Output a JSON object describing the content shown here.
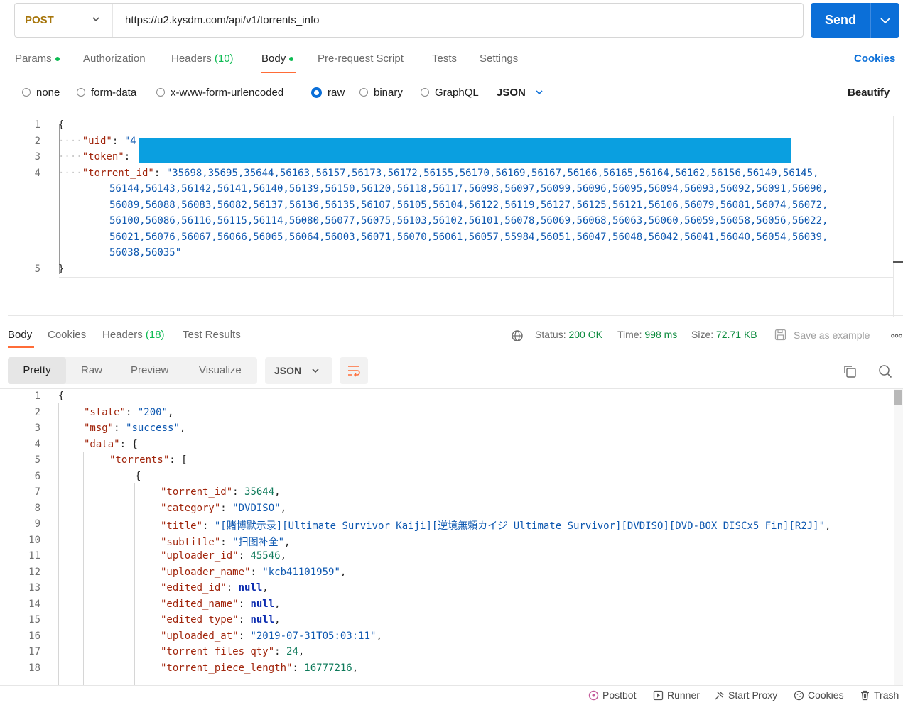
{
  "request": {
    "method": "POST",
    "url": "https://u2.kysdm.com/api/v1/torrents_info",
    "send_label": "Send"
  },
  "request_tabs": {
    "params": "Params",
    "authorization": "Authorization",
    "headers": "Headers",
    "headers_count": "(10)",
    "body": "Body",
    "prerequest": "Pre-request Script",
    "tests": "Tests",
    "settings": "Settings",
    "cookies": "Cookies"
  },
  "body_types": {
    "none": "none",
    "form_data": "form-data",
    "urlencoded": "x-www-form-urlencoded",
    "raw": "raw",
    "binary": "binary",
    "graphql": "GraphQL",
    "format": "JSON",
    "beautify": "Beautify"
  },
  "request_body": {
    "line_numbers": [
      "1",
      "2",
      "3",
      "4",
      "5"
    ],
    "open": "{",
    "close": "}",
    "uid_key": "\"uid\"",
    "uid_value_partial": "\"4",
    "token_key": "\"token\"",
    "torrent_id_key": "\"torrent_id\"",
    "torrent_id_lines": [
      "\"35698,35695,35644,56163,56157,56173,56172,56155,56170,56169,56167,56166,56165,56164,56162,56156,56149,56145,",
      "56144,56143,56142,56141,56140,56139,56150,56120,56118,56117,56098,56097,56099,56096,56095,56094,56093,56092,56091,56090,",
      "56089,56088,56083,56082,56137,56136,56135,56107,56105,56104,56122,56119,56127,56125,56121,56106,56079,56081,56074,56072,",
      "56100,56086,56116,56115,56114,56080,56077,56075,56103,56102,56101,56078,56069,56068,56063,56060,56059,56058,56056,56022,",
      "56021,56076,56067,56066,56065,56064,56003,56071,56070,56061,56057,55984,56051,56047,56048,56042,56041,56040,56054,56039,",
      "56038,56035\""
    ]
  },
  "response_tabs": {
    "body": "Body",
    "cookies": "Cookies",
    "headers": "Headers",
    "headers_count": "(18)",
    "test_results": "Test Results"
  },
  "response_meta": {
    "status_label": "Status:",
    "status_value": "200 OK",
    "time_label": "Time:",
    "time_value": "998 ms",
    "size_label": "Size:",
    "size_value": "72.71 KB",
    "save_example": "Save as example"
  },
  "view_modes": {
    "pretty": "Pretty",
    "raw": "Raw",
    "preview": "Preview",
    "visualize": "Visualize",
    "format": "JSON"
  },
  "response_body": {
    "line_numbers": [
      "1",
      "2",
      "3",
      "4",
      "5",
      "6",
      "7",
      "8",
      "9",
      "10",
      "11",
      "12",
      "13",
      "14",
      "15",
      "16",
      "17",
      "18"
    ],
    "l1": "{",
    "state_key": "\"state\"",
    "state_val": "\"200\"",
    "msg_key": "\"msg\"",
    "msg_val": "\"success\"",
    "data_key": "\"data\"",
    "torrents_key": "\"torrents\"",
    "obj_open": "{",
    "torrent_id_key": "\"torrent_id\"",
    "torrent_id_val": "35644",
    "category_key": "\"category\"",
    "category_val": "\"DVDISO\"",
    "title_key": "\"title\"",
    "title_val": "\"[賭博默示录][Ultimate Survivor Kaiji][逆境無頼カイジ Ultimate Survivor][DVDISO][DVD-BOX DISCx5 Fin][R2J]\"",
    "subtitle_key": "\"subtitle\"",
    "subtitle_val": "\"扫图补全\"",
    "uploader_id_key": "\"uploader_id\"",
    "uploader_id_val": "45546",
    "uploader_name_key": "\"uploader_name\"",
    "uploader_name_val": "\"kcb41101959\"",
    "edited_id_key": "\"edited_id\"",
    "edited_name_key": "\"edited_name\"",
    "edited_type_key": "\"edited_type\"",
    "null_val": "null",
    "uploaded_at_key": "\"uploaded_at\"",
    "uploaded_at_val": "\"2019-07-31T05:03:11\"",
    "torrent_files_qty_key": "\"torrent_files_qty\"",
    "torrent_files_qty_val": "24",
    "torrent_piece_length_key": "\"torrent_piece_length\"",
    "torrent_piece_length_val": "16777216"
  },
  "footer": {
    "postbot": "Postbot",
    "runner": "Runner",
    "start_proxy": "Start Proxy",
    "cookies": "Cookies",
    "trash": "Trash"
  },
  "colors": {
    "accent": "#ff6c37",
    "primary": "#0b6fd8",
    "success": "#0cbb52",
    "method_post": "#a7760c",
    "redaction": "#0a9fe0"
  }
}
